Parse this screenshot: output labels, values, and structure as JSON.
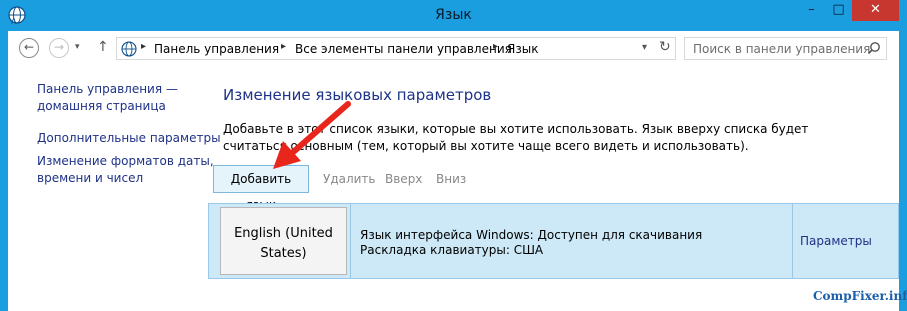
{
  "window": {
    "title": "Язык",
    "controls": {
      "minimize": "–",
      "maximize": "□",
      "close": "✕"
    }
  },
  "address": {
    "breadcrumbs": [
      "Панель управления",
      "Все элементы панели управления",
      "Язык"
    ]
  },
  "search": {
    "placeholder": "Поиск в панели управления"
  },
  "left_nav": {
    "home_line1": "Панель управления —",
    "home_line2": "домашняя страница",
    "advanced": "Дополнительные параметры",
    "formats_line1": "Изменение форматов даты,",
    "formats_line2": "времени и чисел"
  },
  "main": {
    "heading": "Изменение языковых параметров",
    "description": "Добавьте в этот список языки, которые вы хотите использовать. Язык вверху списка будет считаться основным (тем, который вы хотите чаще всего видеть и использовать)."
  },
  "toolbar": {
    "add": "Добавить язык",
    "remove": "Удалить",
    "up": "Вверх",
    "down": "Вниз"
  },
  "languages": [
    {
      "name_line1": "English (United",
      "name_line2": "States)",
      "interface": "Язык интерфейса Windows: Доступен для скачивания",
      "layout": "Раскладка клавиатуры: США",
      "options": "Параметры"
    }
  ],
  "watermark": "CompFixer.info",
  "colors": {
    "titlebar": "#1b9ee0",
    "link": "#1e3287",
    "selected_row": "#cde8f6",
    "close_button": "#c7372f",
    "annotation_arrow": "#e8261c"
  }
}
